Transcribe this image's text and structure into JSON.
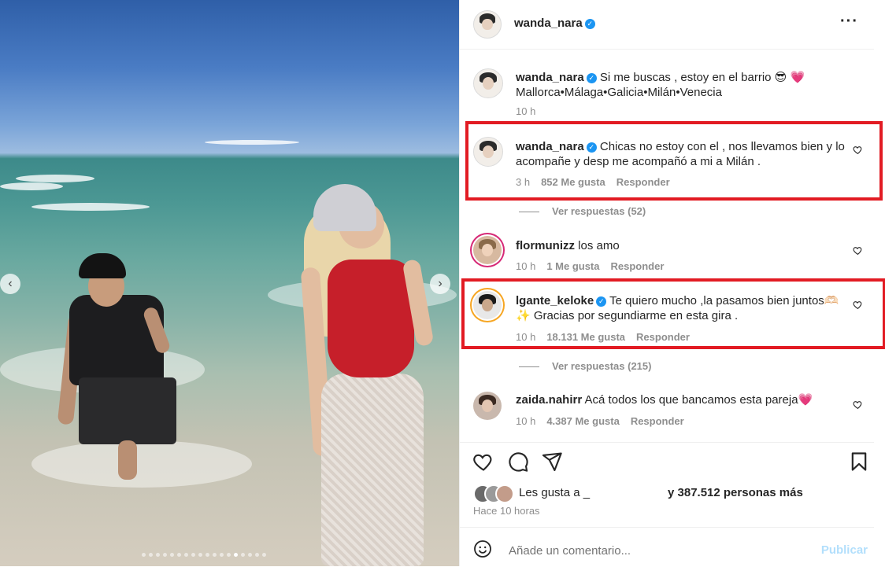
{
  "post": {
    "author": "wanda_nara",
    "image_dots_count": 18,
    "image_dot_active": 13
  },
  "header": {
    "username": "wanda_nara",
    "more_icon": "more-horizontal-icon"
  },
  "caption": {
    "username": "wanda_nara",
    "line1": "Si me buscas , estoy en el barrio 😎 💗",
    "line2": "Mallorca•Málaga•Galicia•Milán•Venecia",
    "time": "10 h"
  },
  "comments": [
    {
      "username": "wanda_nara",
      "verified": true,
      "line1": "Chicas no estoy con el , nos llevamos bien y lo",
      "line2": "acompañe y desp me acompañó a mi a Milán .",
      "time": "3 h",
      "likes": "852 Me gusta",
      "reply": "Responder",
      "view_replies": "Ver respuestas (52)"
    },
    {
      "username": "flormunizz",
      "verified": false,
      "line1": "los amo",
      "time": "10 h",
      "likes": "1 Me gusta",
      "reply": "Responder"
    },
    {
      "username": "lgante_keloke",
      "verified": true,
      "line1": "Te quiero mucho ,la pasamos bien juntos🫶🏻",
      "line2": "✨ Gracias por segundiarme en esta gira .",
      "time": "10 h",
      "likes": "18.131 Me gusta",
      "reply": "Responder",
      "view_replies": "Ver respuestas (215)"
    },
    {
      "username": "zaida.nahirr",
      "verified": false,
      "line1": "Acá todos los que bancamos esta pareja💗",
      "time": "10 h",
      "likes": "4.387 Me gusta",
      "reply": "Responder"
    }
  ],
  "actions": {
    "like_icon": "heart-icon",
    "comment_icon": "comment-icon",
    "share_icon": "send-icon",
    "save_icon": "bookmark-icon"
  },
  "likes": {
    "prefix": "Les gusta a",
    "name": "_",
    "suffix": "y 387.512 personas más",
    "posted": "Hace 10 horas"
  },
  "add_comment": {
    "placeholder": "Añade un comentario...",
    "publish": "Publicar"
  },
  "colors": {
    "highlight_box": "#e21b23",
    "verified": "#1b95f2",
    "publish_disabled": "#b2dffc"
  }
}
